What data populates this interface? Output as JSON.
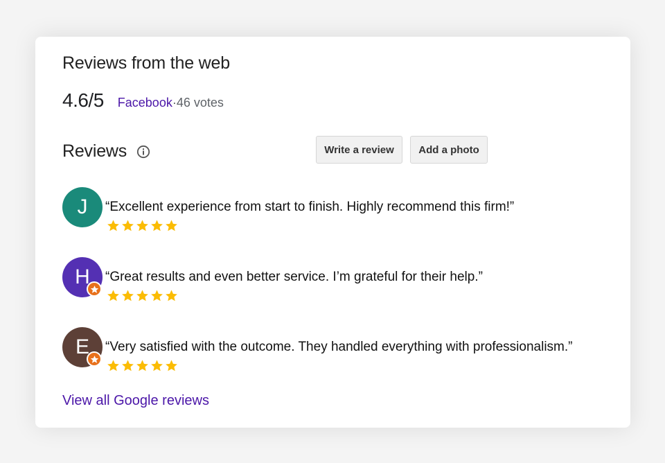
{
  "web_reviews": {
    "title": "Reviews from the web",
    "score": "4.6/5",
    "source": "Facebook",
    "separator": " · ",
    "votes": "46 votes"
  },
  "reviews_section": {
    "title": "Reviews",
    "info_icon": "info-icon",
    "write_review_label": "Write a review",
    "add_photo_label": "Add a photo"
  },
  "reviews": [
    {
      "initial": "J",
      "avatar_color": "#1a8a7a",
      "local_guide_badge": false,
      "text": "“Excellent experience from start to finish. Highly recommend this firm!”",
      "rating": 5
    },
    {
      "initial": "H",
      "avatar_color": "#5430b3",
      "local_guide_badge": true,
      "text": "“Great results and even better service. I’m grateful for their help.”",
      "rating": 5
    },
    {
      "initial": "E",
      "avatar_color": "#5d4037",
      "local_guide_badge": true,
      "text": "“Very satisfied with the outcome. They handled everything with professionalism.”",
      "rating": 5
    }
  ],
  "view_all_label": "View all Google reviews",
  "colors": {
    "link": "#4b16a8",
    "star": "#fbbc04",
    "badge": "#e8711c"
  }
}
